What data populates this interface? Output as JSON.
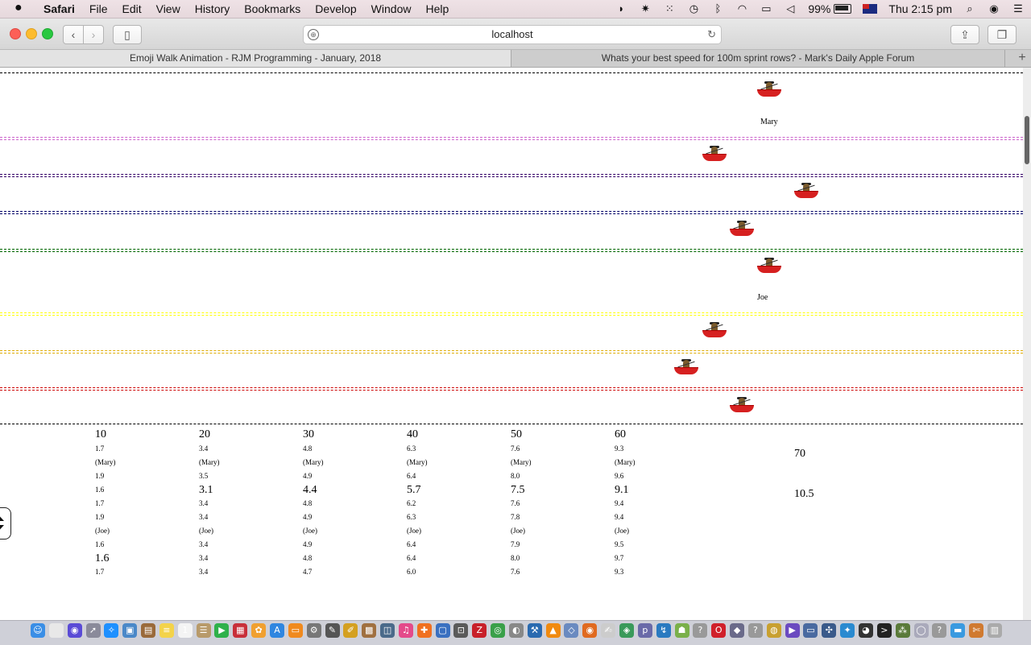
{
  "menubar": {
    "apple": "",
    "app": "Safari",
    "menus": [
      "File",
      "Edit",
      "View",
      "History",
      "Bookmarks",
      "Develop",
      "Window",
      "Help"
    ],
    "battery": "99%",
    "clock": "Thu 2:15 pm"
  },
  "toolbar": {
    "address": "localhost"
  },
  "tabs": [
    {
      "label": "Emoji Walk Animation - RJM Programming - January, 2018"
    },
    {
      "label": "Whats your best speed for 100m sprint rows? - Mark's Daily Apple Forum"
    }
  ],
  "lanes": {
    "divider_colors": [
      "#000000",
      "#cc66cc",
      "#330066",
      "#000066",
      "#006600",
      "#ffff00",
      "#ddaa00",
      "#cc0000",
      "#000000"
    ]
  },
  "rowers": {
    "name_labels": [
      "Mary",
      "Joe"
    ]
  },
  "table": {
    "columns": [
      {
        "head": "10",
        "cells": [
          {
            "text": "1.7",
            "big": false
          },
          {
            "text": "(Mary)",
            "big": false
          },
          {
            "text": "1.9",
            "big": false
          },
          {
            "text": "1.6",
            "big": false
          },
          {
            "text": "1.7",
            "big": false
          },
          {
            "text": "1.9",
            "big": false
          },
          {
            "text": "(Joe)",
            "big": false
          },
          {
            "text": "1.6",
            "big": false
          },
          {
            "text": "1.6",
            "big": true
          },
          {
            "text": "1.7",
            "big": false
          }
        ]
      },
      {
        "head": "20",
        "cells": [
          {
            "text": "3.4",
            "big": false
          },
          {
            "text": "(Mary)",
            "big": false
          },
          {
            "text": "3.5",
            "big": false
          },
          {
            "text": "3.1",
            "big": true
          },
          {
            "text": "3.4",
            "big": false
          },
          {
            "text": "3.4",
            "big": false
          },
          {
            "text": "(Joe)",
            "big": false
          },
          {
            "text": "3.4",
            "big": false
          },
          {
            "text": "3.4",
            "big": false
          },
          {
            "text": "3.4",
            "big": false
          }
        ]
      },
      {
        "head": "30",
        "cells": [
          {
            "text": "4.8",
            "big": false
          },
          {
            "text": "(Mary)",
            "big": false
          },
          {
            "text": "4.9",
            "big": false
          },
          {
            "text": "4.4",
            "big": true
          },
          {
            "text": "4.8",
            "big": false
          },
          {
            "text": "4.9",
            "big": false
          },
          {
            "text": "(Joe)",
            "big": false
          },
          {
            "text": "4.9",
            "big": false
          },
          {
            "text": "4.8",
            "big": false
          },
          {
            "text": "4.7",
            "big": false
          }
        ]
      },
      {
        "head": "40",
        "cells": [
          {
            "text": "6.3",
            "big": false
          },
          {
            "text": "(Mary)",
            "big": false
          },
          {
            "text": "6.4",
            "big": false
          },
          {
            "text": "5.7",
            "big": true
          },
          {
            "text": "6.2",
            "big": false
          },
          {
            "text": "6.3",
            "big": false
          },
          {
            "text": "(Joe)",
            "big": false
          },
          {
            "text": "6.4",
            "big": false
          },
          {
            "text": "6.4",
            "big": false
          },
          {
            "text": "6.0",
            "big": false
          }
        ]
      },
      {
        "head": "50",
        "cells": [
          {
            "text": "7.6",
            "big": false
          },
          {
            "text": "(Mary)",
            "big": false
          },
          {
            "text": "8.0",
            "big": false
          },
          {
            "text": "7.5",
            "big": true
          },
          {
            "text": "7.6",
            "big": false
          },
          {
            "text": "7.8",
            "big": false
          },
          {
            "text": "(Joe)",
            "big": false
          },
          {
            "text": "7.9",
            "big": false
          },
          {
            "text": "8.0",
            "big": false
          },
          {
            "text": "7.6",
            "big": false
          }
        ]
      },
      {
        "head": "60",
        "cells": [
          {
            "text": "9.3",
            "big": false
          },
          {
            "text": "(Mary)",
            "big": false
          },
          {
            "text": "9.6",
            "big": false
          },
          {
            "text": "9.1",
            "big": true
          },
          {
            "text": "9.4",
            "big": false
          },
          {
            "text": "9.4",
            "big": false
          },
          {
            "text": "(Joe)",
            "big": false
          },
          {
            "text": "9.5",
            "big": false
          },
          {
            "text": "9.7",
            "big": false
          },
          {
            "text": "9.3",
            "big": false
          }
        ]
      }
    ],
    "col70": {
      "head": "70",
      "value": "10.5"
    }
  },
  "dock": {
    "items": [
      {
        "name": "finder-icon",
        "glyph": "☺",
        "color": "#3a8ee6"
      },
      {
        "name": "document-icon",
        "glyph": "",
        "color": "#e8e8e8"
      },
      {
        "name": "siri-icon",
        "glyph": "◉",
        "color": "#5a4bd6"
      },
      {
        "name": "launchpad-icon",
        "glyph": "➚",
        "color": "#8a8a9a"
      },
      {
        "name": "safari-icon",
        "glyph": "✧",
        "color": "#1e90ff"
      },
      {
        "name": "preview-icon",
        "glyph": "▣",
        "color": "#4a88c8"
      },
      {
        "name": "notebook-icon",
        "glyph": "▤",
        "color": "#9a6a3a"
      },
      {
        "name": "notes-icon",
        "glyph": "≡",
        "color": "#f3d34a"
      },
      {
        "name": "calendar-icon",
        "glyph": "1",
        "color": "#f4f4f4"
      },
      {
        "name": "contacts-icon",
        "glyph": "☰",
        "color": "#b89a6a"
      },
      {
        "name": "facetime-icon",
        "glyph": "▶",
        "color": "#2fb14a"
      },
      {
        "name": "photo-booth-icon",
        "glyph": "▦",
        "color": "#c8303a"
      },
      {
        "name": "photos-icon",
        "glyph": "✿",
        "color": "#f0a030"
      },
      {
        "name": "app-store-icon",
        "glyph": "A",
        "color": "#2f86e0"
      },
      {
        "name": "ibooks-icon",
        "glyph": "▭",
        "color": "#f08a1e"
      },
      {
        "name": "system-preferences-icon",
        "glyph": "⚙",
        "color": "#777"
      },
      {
        "name": "script-editor-icon",
        "glyph": "✎",
        "color": "#555"
      },
      {
        "name": "bbedit-icon",
        "glyph": "✐",
        "color": "#d4a020"
      },
      {
        "name": "archive-icon",
        "glyph": "▩",
        "color": "#a07040"
      },
      {
        "name": "image-capture-icon",
        "glyph": "◫",
        "color": "#4a6a8a"
      },
      {
        "name": "itunes-icon",
        "glyph": "♫",
        "color": "#e44a8a"
      },
      {
        "name": "gimp-icon",
        "glyph": "✚",
        "color": "#f07020"
      },
      {
        "name": "screen-sharing-icon",
        "glyph": "▢",
        "color": "#3a70c0"
      },
      {
        "name": "screenshot-icon",
        "glyph": "⊡",
        "color": "#5a5a5a"
      },
      {
        "name": "filezilla-icon",
        "glyph": "Z",
        "color": "#c8202a"
      },
      {
        "name": "chrome-icon",
        "glyph": "◎",
        "color": "#3aa04a"
      },
      {
        "name": "activity-monitor-icon",
        "glyph": "◐",
        "color": "#888"
      },
      {
        "name": "xcode-icon",
        "glyph": "⚒",
        "color": "#2a6ab0"
      },
      {
        "name": "vlc-icon",
        "glyph": "▲",
        "color": "#f08a10"
      },
      {
        "name": "virtualbox-icon",
        "glyph": "◇",
        "color": "#6a8ac0"
      },
      {
        "name": "firefox-icon",
        "glyph": "◉",
        "color": "#e06a20"
      },
      {
        "name": "textedit-icon",
        "glyph": "✍",
        "color": "#ccc"
      },
      {
        "name": "android-studio-icon",
        "glyph": "◈",
        "color": "#3a9a5a"
      },
      {
        "name": "php-icon",
        "glyph": "p",
        "color": "#6a6aa8"
      },
      {
        "name": "sketchup-icon",
        "glyph": "↯",
        "color": "#2a7ac0"
      },
      {
        "name": "android-icon",
        "glyph": "☗",
        "color": "#7ab04a"
      },
      {
        "name": "unknown-app-icon",
        "glyph": "?",
        "color": "#999"
      },
      {
        "name": "opera-icon",
        "glyph": "O",
        "color": "#d0202a"
      },
      {
        "name": "cube-app-icon",
        "glyph": "◆",
        "color": "#6a6a8a"
      },
      {
        "name": "unknown-app-icon-2",
        "glyph": "?",
        "color": "#999"
      },
      {
        "name": "cyberduck-icon",
        "glyph": "◍",
        "color": "#c8a030"
      },
      {
        "name": "visual-studio-icon",
        "glyph": "▶",
        "color": "#6a4ac0"
      },
      {
        "name": "monitor-icon",
        "glyph": "▭",
        "color": "#4a6aa0"
      },
      {
        "name": "network-icon",
        "glyph": "✣",
        "color": "#3a5a8a"
      },
      {
        "name": "paint-icon",
        "glyph": "✦",
        "color": "#2a8ad0"
      },
      {
        "name": "github-icon",
        "glyph": "◕",
        "color": "#333"
      },
      {
        "name": "terminal-icon",
        "glyph": ">",
        "color": "#222"
      },
      {
        "name": "cluster-icon",
        "glyph": "⁂",
        "color": "#5a7a3a"
      },
      {
        "name": "drop-icon",
        "glyph": "◯",
        "color": "#aab"
      },
      {
        "name": "unknown-app-icon-3",
        "glyph": "?",
        "color": "#999"
      },
      {
        "name": "folder-icon",
        "glyph": "▬",
        "color": "#3a9ae0"
      },
      {
        "name": "brush-icon",
        "glyph": "✄",
        "color": "#d07a30"
      },
      {
        "name": "trash-icon",
        "glyph": "▥",
        "color": "#aaa"
      }
    ]
  }
}
